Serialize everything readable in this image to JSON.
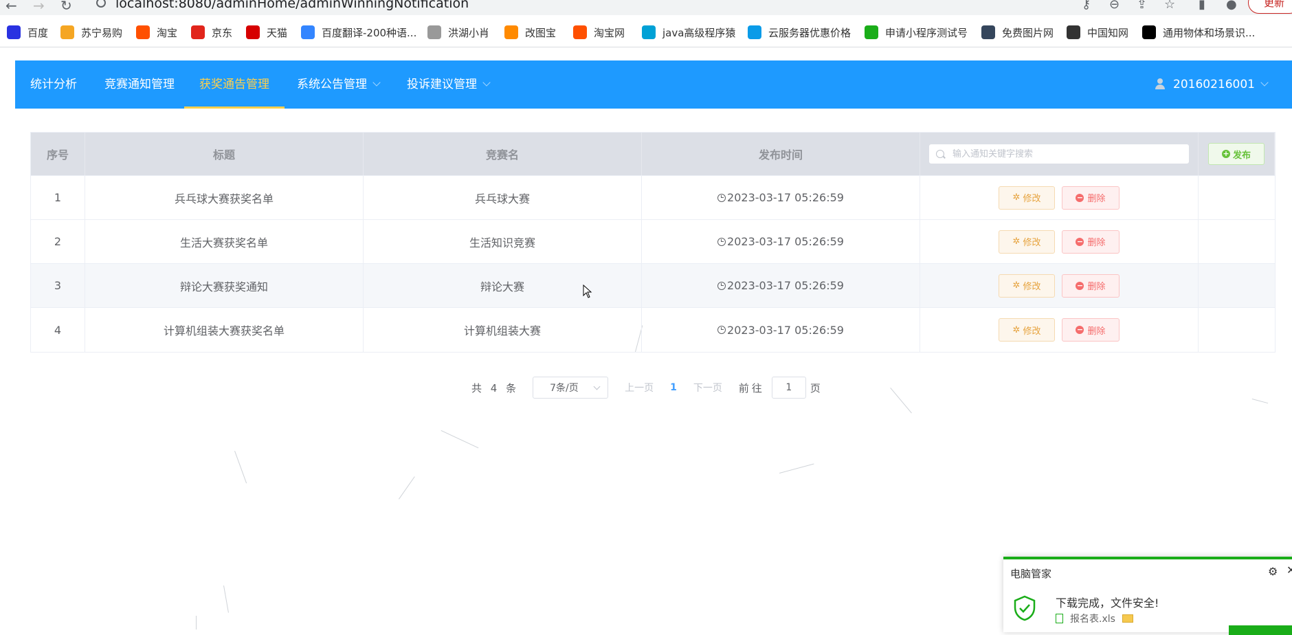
{
  "browser": {
    "url": "localhost:8080/adminHome/adminWinningNotification",
    "update_label": "更新",
    "bookmarks": [
      {
        "label": "百度",
        "color": "#2932e1"
      },
      {
        "label": "苏宁易购",
        "color": "#f5a623"
      },
      {
        "label": "淘宝",
        "color": "#ff5000"
      },
      {
        "label": "京东",
        "color": "#e1251b"
      },
      {
        "label": "天猫",
        "color": "#d60000"
      },
      {
        "label": "百度翻译-200种语...",
        "color": "#3385ff"
      },
      {
        "label": "洪湖小肖",
        "color": "#999999"
      },
      {
        "label": "改图宝",
        "color": "#ff8a00"
      },
      {
        "label": "淘宝网",
        "color": "#ff5000"
      },
      {
        "label": "java高级程序猿",
        "color": "#00a1d6"
      },
      {
        "label": "云服务器优惠价格",
        "color": "#0a9be8"
      },
      {
        "label": "申请小程序测试号",
        "color": "#1aad19"
      },
      {
        "label": "免费图片网",
        "color": "#35465c"
      },
      {
        "label": "中国知网",
        "color": "#333333"
      },
      {
        "label": "通用物体和场景识...",
        "color": "#000000"
      }
    ]
  },
  "nav": {
    "items": [
      {
        "label": "统计分析"
      },
      {
        "label": "竞赛通知管理"
      },
      {
        "label": "获奖通告管理",
        "active": true
      },
      {
        "label": "系统公告管理",
        "dropdown": true
      },
      {
        "label": "投诉建议管理",
        "dropdown": true
      }
    ],
    "user": "20160216001"
  },
  "table": {
    "headers": [
      "序号",
      "标题",
      "竞赛名",
      "发布时间"
    ],
    "search_placeholder": "输入通知关键字搜索",
    "publish_label": "发布",
    "edit_label": "修改",
    "delete_label": "删除",
    "rows": [
      {
        "index": "1",
        "title": "兵乓球大赛获奖名单",
        "contest": "兵乓球大赛",
        "time": "2023-03-17 05:26:59"
      },
      {
        "index": "2",
        "title": "生活大赛获奖名单",
        "contest": "生活知识竞赛",
        "time": "2023-03-17 05:26:59"
      },
      {
        "index": "3",
        "title": "辩论大赛获奖通知",
        "contest": "辩论大赛",
        "time": "2023-03-17 05:26:59"
      },
      {
        "index": "4",
        "title": "计算机组装大赛获奖名单",
        "contest": "计算机组装大赛",
        "time": "2023-03-17 05:26:59"
      }
    ]
  },
  "pagination": {
    "total_text": "共 4 条",
    "page_size": "7条/页",
    "prev": "上一页",
    "current": "1",
    "next": "下一页",
    "goto_prefix": "前往",
    "goto_value": "1",
    "goto_suffix": "页"
  },
  "notification": {
    "app": "电脑管家",
    "message": "下载完成，文件安全!",
    "file": "报名表.xls"
  }
}
